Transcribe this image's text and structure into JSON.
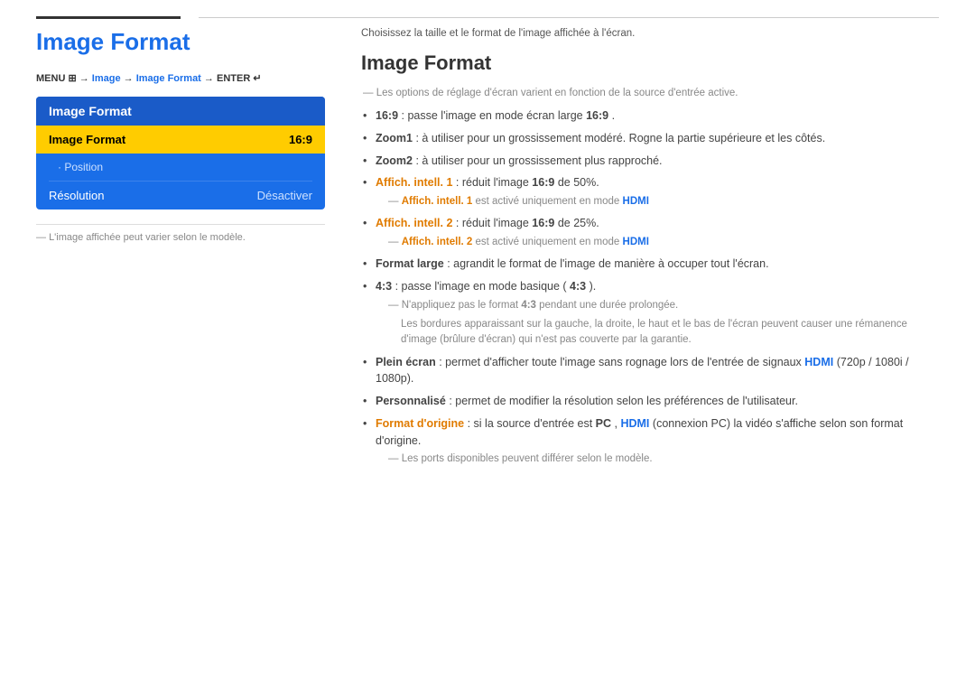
{
  "topline": {},
  "left": {
    "page_title": "Image Format",
    "menu_path_parts": [
      "MENU",
      "→",
      "Image",
      "→",
      "Image Format",
      "→",
      "ENTER"
    ],
    "menu_box_header": "Image Format",
    "menu_selected_label": "Image Format",
    "menu_selected_value": "16:9",
    "menu_sub_item": "· Position",
    "menu_normal_label": "Résolution",
    "menu_normal_value": "Désactiver",
    "left_note": "L'image affichée peut varier selon le modèle."
  },
  "right": {
    "subtitle": "Choisissez la taille et le format de l'image affichée à l'écran.",
    "section_title": "Image Format",
    "note": "Les options de réglage d'écran varient en fonction de la source d'entrée active.",
    "bullets": [
      {
        "id": 1,
        "text_bold": "16:9",
        "text_rest": " : passe l'image en mode écran large ",
        "text_bold2": "16:9",
        "text_rest2": ".",
        "sub_note": null
      },
      {
        "id": 2,
        "text_bold": "Zoom1",
        "text_rest": " : à utiliser pour un grossissement modéré. Rogne la partie supérieure et les côtés.",
        "sub_note": null
      },
      {
        "id": 3,
        "text_bold": "Zoom2",
        "text_rest": " : à utiliser pour un grossissement plus rapproché.",
        "sub_note": null
      },
      {
        "id": 4,
        "text_orange": "Affich. intell. 1",
        "text_rest": " : réduit l'image ",
        "text_bold_inner": "16:9",
        "text_rest2": " de 50%.",
        "sub_note": "Affich. intell. 1 est activé uniquement en mode HDMI",
        "sub_note_orange": "Affich. intell. 1",
        "sub_note_rest": " est activé uniquement en mode ",
        "sub_note_blue": "HDMI"
      },
      {
        "id": 5,
        "text_orange": "Affich. intell. 2",
        "text_rest": " : réduit l'image ",
        "text_bold_inner": "16:9",
        "text_rest2": " de 25%.",
        "sub_note_orange": "Affich. intell. 2",
        "sub_note_rest": " est activé uniquement en mode ",
        "sub_note_blue": "HDMI"
      },
      {
        "id": 6,
        "text_bold": "Format large",
        "text_rest": " : agrandit le format de l'image de manière à occuper tout l'écran.",
        "sub_note": null
      },
      {
        "id": 7,
        "text_bold": "4:3",
        "text_rest": " : passe l'image en mode basique (",
        "text_bold2": "4:3",
        "text_rest2": ").",
        "sub_note1": "N'appliquez pas le format 4:3 pendant une durée prolongée.",
        "sub_note1_bold": "4:3",
        "sub_note2": "Les bordures apparaissant sur la gauche, la droite, le haut et le bas de l'écran peuvent causer une rémanence d'image (brûlure d'écran) qui n'est pas couverte par la garantie."
      },
      {
        "id": 8,
        "text_bold": "Plein écran",
        "text_rest": " : permet d'afficher toute l'image sans rognage lors de l'entrée de signaux ",
        "text_blue": "HDMI",
        "text_rest2": " (720p / 1080i / 1080p).",
        "sub_note": null
      },
      {
        "id": 9,
        "text_bold": "Personnalisé",
        "text_rest": " : permet de modifier la résolution selon les préférences de l'utilisateur.",
        "sub_note": null
      },
      {
        "id": 10,
        "text_orange": "Format d'origine",
        "text_rest": " : si la source d'entrée est ",
        "text_bold_pc": "PC",
        "text_comma": ", ",
        "text_blue": "HDMI",
        "text_rest2": " (connexion PC) la vidéo s'affiche selon son format d'origine.",
        "sub_note_final": "Les ports disponibles peuvent différer selon le modèle."
      }
    ]
  }
}
